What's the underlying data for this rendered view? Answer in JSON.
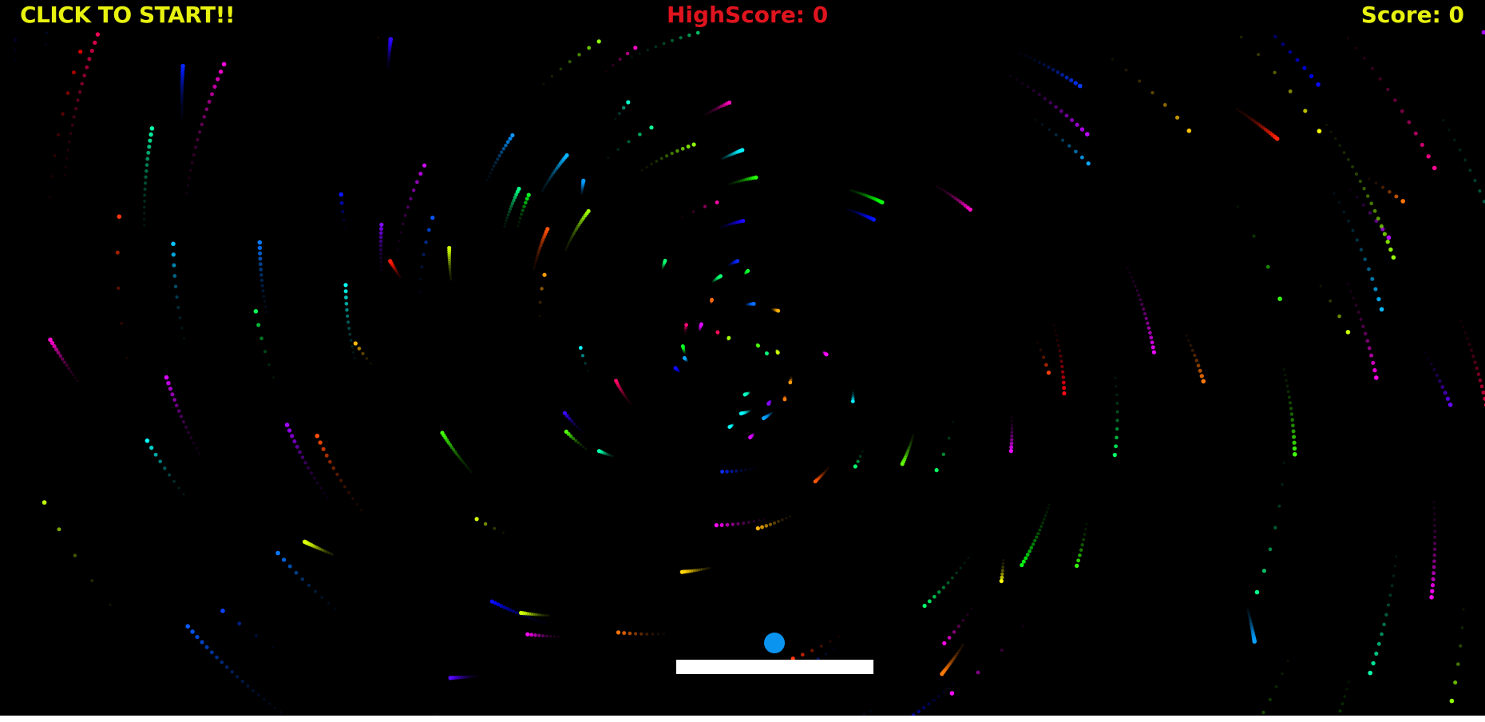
{
  "hud": {
    "start_label": "CLICK TO START!!",
    "highscore_label": "HighScore:",
    "highscore_value": "0",
    "score_label": "Score:",
    "score_value": "0"
  },
  "colors": {
    "background": "#000000",
    "start_text": "#e8f20f",
    "highscore_text": "#e0141e",
    "score_text": "#e8f20f",
    "ball": "#0a94f0",
    "paddle": "#ffffff"
  },
  "icons": {
    "ball": "ball-icon",
    "paddle": "paddle-icon",
    "particles": "rainbow-particle-spiral"
  }
}
